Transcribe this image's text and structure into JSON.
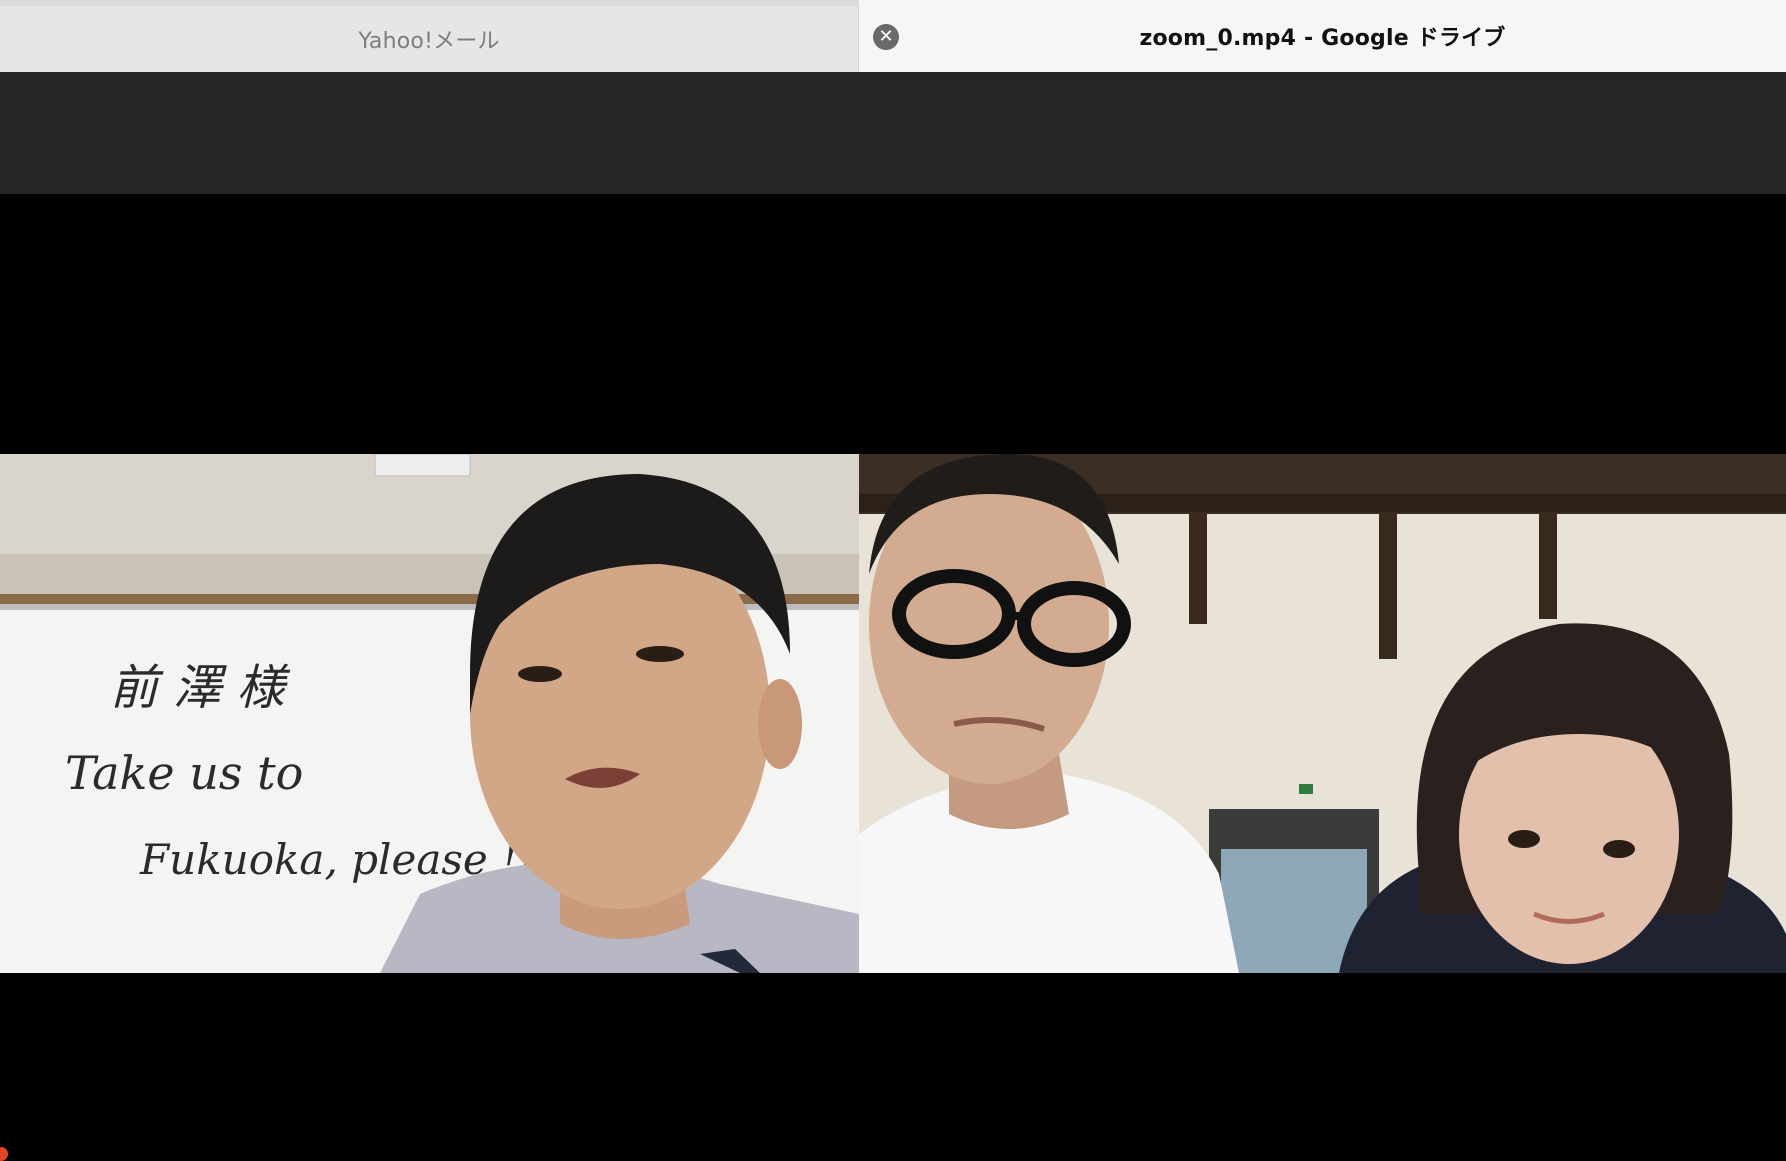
{
  "tabs": [
    {
      "label": "Yahoo!メール",
      "active": false
    },
    {
      "label": "zoom_0.mp4 - Google ドライブ",
      "active": true
    }
  ],
  "close_icon": "close-circle-icon",
  "whiteboard": {
    "line1": "前 澤 様",
    "line2": "Take us to",
    "line3": "Fukuoka, please !!"
  },
  "colors": {
    "tab_active_bg": "#f6f6f6",
    "tab_inactive_bg": "#e6e6e6",
    "top_strip": "#262626",
    "player_bg": "#000000"
  }
}
